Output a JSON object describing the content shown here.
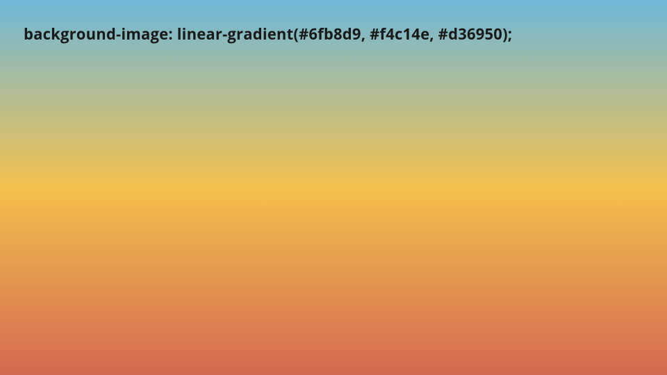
{
  "slide": {
    "code_text": "background-image: linear-gradient(#6fb8d9, #f4c14e, #d36950);",
    "gradient_colors": [
      "#6fb8d9",
      "#f4c14e",
      "#d36950"
    ]
  }
}
